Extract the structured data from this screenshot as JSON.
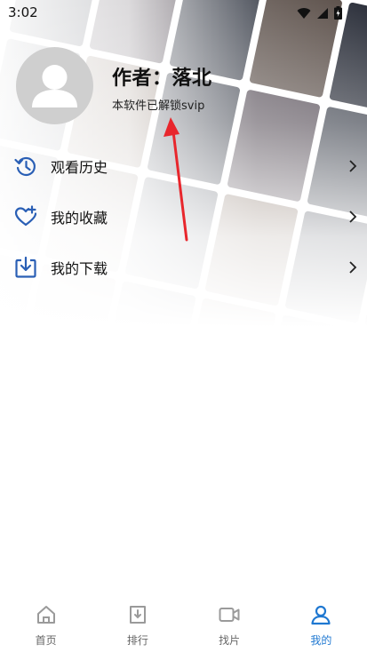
{
  "status_bar": {
    "time": "3:02",
    "icons": [
      "wifi-icon",
      "signal-icon",
      "battery-icon"
    ]
  },
  "profile": {
    "author": "作者：落北",
    "subtitle": "本软件已解锁svip",
    "avatar_icon": "user-avatar-icon"
  },
  "menu": {
    "items": [
      {
        "label": "观看历史",
        "icon": "history-icon"
      },
      {
        "label": "我的收藏",
        "icon": "favorite-heart-icon"
      },
      {
        "label": "我的下载",
        "icon": "download-icon"
      }
    ]
  },
  "bottom_nav": {
    "items": [
      {
        "label": "首页",
        "icon": "home-icon",
        "active": false
      },
      {
        "label": "排行",
        "icon": "ranking-icon",
        "active": false
      },
      {
        "label": "找片",
        "icon": "video-camera-icon",
        "active": false
      },
      {
        "label": "我的",
        "icon": "profile-icon",
        "active": true
      }
    ]
  },
  "colors": {
    "accent": "#1f78d1",
    "icon_blue": "#2a5fb5",
    "inactive_nav": "#9a9a9a",
    "annotation_red": "#e8262c",
    "avatar_bg": "#cfcfcf"
  }
}
